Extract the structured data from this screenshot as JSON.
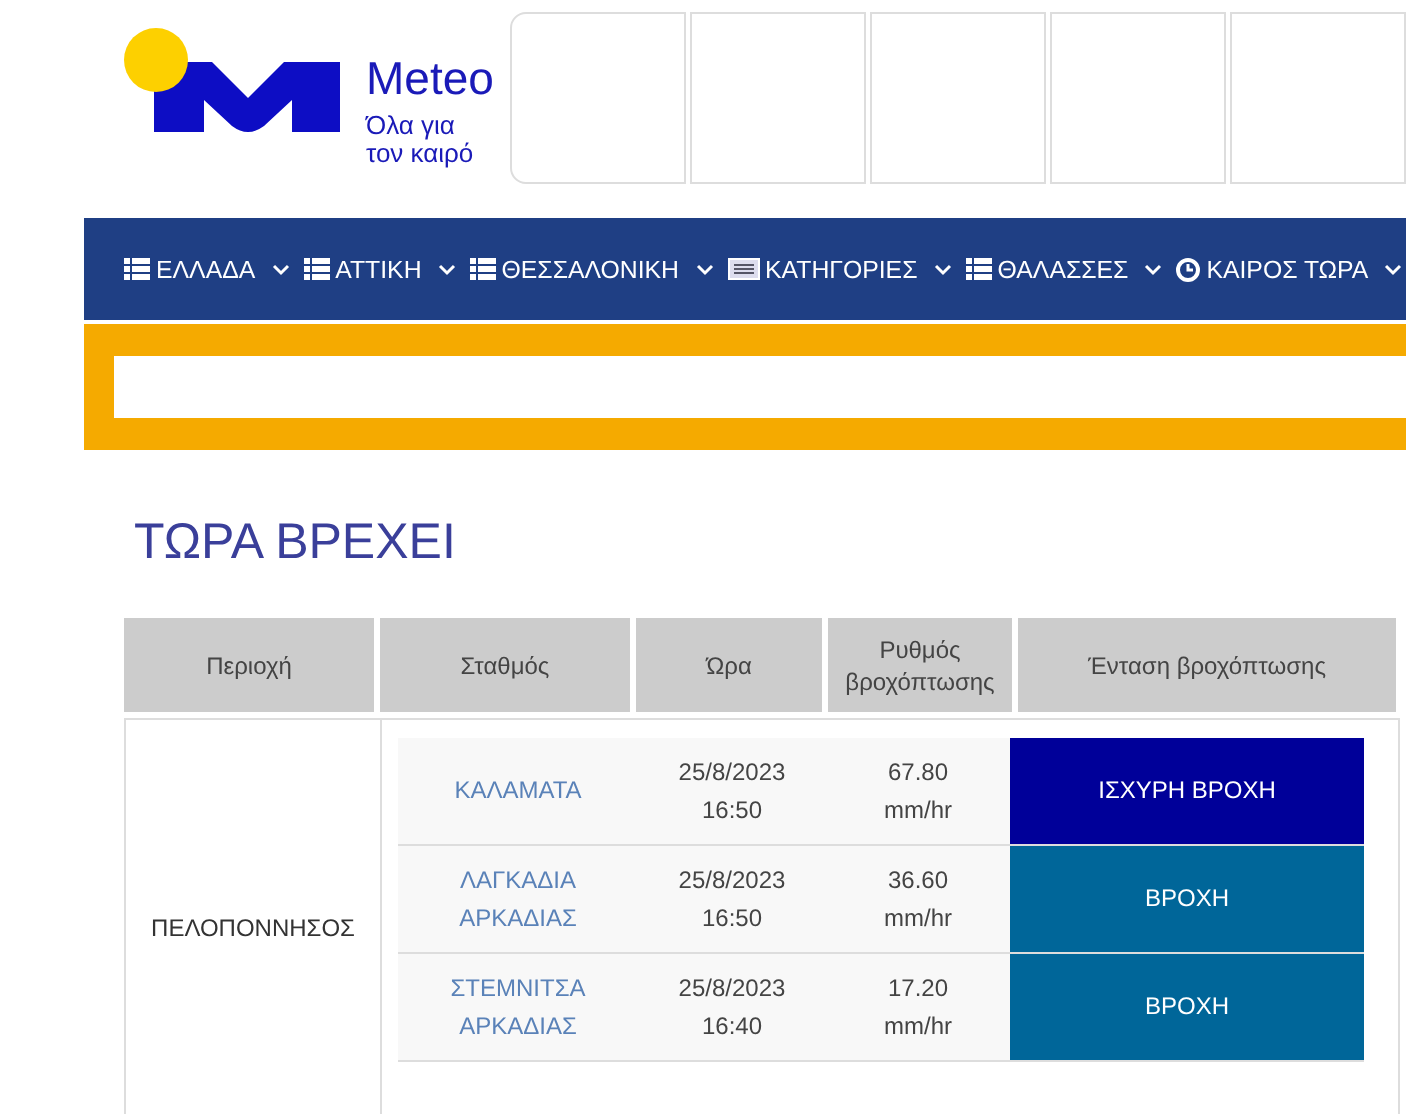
{
  "logo": {
    "name": "Meteo",
    "tagline": "Όλα για τον καιρό"
  },
  "nav": [
    {
      "label": "ΕΛΛΑΔΑ",
      "kind": "list"
    },
    {
      "label": "ΑΤΤΙΚΗ",
      "kind": "list"
    },
    {
      "label": "ΘΕΣΣΑΛΟΝΙΚΗ",
      "kind": "list"
    },
    {
      "label": "ΚΑΤΗΓΟΡΙΕΣ",
      "kind": "card"
    },
    {
      "label": "ΘΑΛΑΣΣΕΣ",
      "kind": "list"
    },
    {
      "label": "ΚΑΙΡΟΣ ΤΩΡΑ",
      "kind": "clock"
    }
  ],
  "title": "ΤΩΡΑ ΒΡΕΧΕΙ",
  "table": {
    "columns": [
      "Περιοχή",
      "Σταθμός",
      "Ώρα",
      "Ρυθμός βροχόπτωσης",
      "Ένταση βροχόπτωσης"
    ],
    "region": "ΠΕΛΟΠΟΝΝΗΣΟΣ",
    "rows": [
      {
        "station": "ΚΑΛΑΜΑΤΑ",
        "date": "25/8/2023",
        "time": "16:50",
        "rate": "67.80",
        "unit": "mm/hr",
        "intensity": "ΙΣΧΥΡΗ ΒΡΟΧΗ",
        "color": "#000099"
      },
      {
        "station": "ΛΑΓΚΑΔΙΑ ΑΡΚΑΔΙΑΣ",
        "date": "25/8/2023",
        "time": "16:50",
        "rate": "36.60",
        "unit": "mm/hr",
        "intensity": "ΒΡΟΧΗ",
        "color": "#006699"
      },
      {
        "station": "ΣΤΕΜΝΙΤΣΑ ΑΡΚΑΔΙΑΣ",
        "date": "25/8/2023",
        "time": "16:40",
        "rate": "17.20",
        "unit": "mm/hr",
        "intensity": "ΒΡΟΧΗ",
        "color": "#006699"
      }
    ]
  }
}
